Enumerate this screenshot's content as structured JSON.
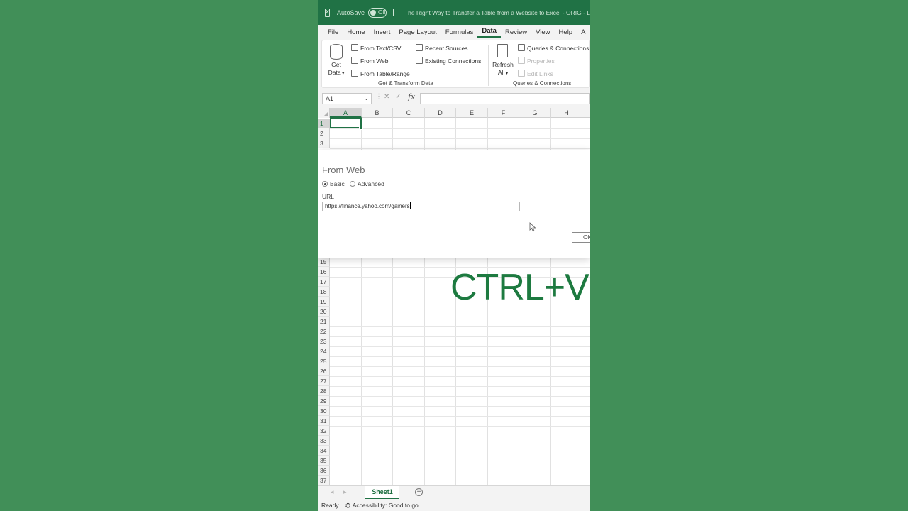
{
  "titlebar": {
    "autosave_label": "AutoSave",
    "autosave_state": "Off",
    "title": "The Right Way to Transfer a Table from a Website to Excel - ORIG - L"
  },
  "menu": {
    "items": [
      "File",
      "Home",
      "Insert",
      "Page Layout",
      "Formulas",
      "Data",
      "Review",
      "View",
      "Help",
      "A"
    ],
    "active": "Data"
  },
  "ribbon": {
    "get_data": {
      "line1": "Get",
      "line2": "Data"
    },
    "from_text_csv": "From Text/CSV",
    "from_web": "From Web",
    "from_table_range": "From Table/Range",
    "recent_sources": "Recent Sources",
    "existing_connections": "Existing Connections",
    "group_get_transform": "Get & Transform Data",
    "refresh_all": {
      "line1": "Refresh",
      "line2": "All"
    },
    "queries_connections": "Queries & Connections",
    "properties": "Properties",
    "edit_links": "Edit Links",
    "group_queries": "Queries & Connections"
  },
  "formula_bar": {
    "name_box": "A1",
    "fx": "fx",
    "formula": ""
  },
  "grid": {
    "columns": [
      "A",
      "B",
      "C",
      "D",
      "E",
      "F",
      "G",
      "H"
    ],
    "top_rows": [
      "1",
      "2",
      "3"
    ],
    "bottom_rows": [
      "15",
      "16",
      "17",
      "18",
      "19",
      "20",
      "21",
      "22",
      "23",
      "24",
      "25",
      "26",
      "27",
      "28",
      "29",
      "30",
      "31",
      "32",
      "33",
      "34",
      "35",
      "36",
      "37"
    ],
    "selected_cell": "A1"
  },
  "dialog": {
    "title": "From Web",
    "mode_basic": "Basic",
    "mode_advanced": "Advanced",
    "selected_mode": "Basic",
    "url_label": "URL",
    "url_value": "https://finance.yahoo.com/gainers",
    "ok_label": "OK"
  },
  "overlay": {
    "text": "CTRL+V",
    "color": "#1d7a40"
  },
  "sheets": {
    "tabs": [
      "Sheet1"
    ],
    "active": "Sheet1"
  },
  "status": {
    "ready": "Ready",
    "accessibility": "Accessibility: Good to go"
  },
  "colors": {
    "background": "#418f58",
    "excel_green": "#207245"
  }
}
